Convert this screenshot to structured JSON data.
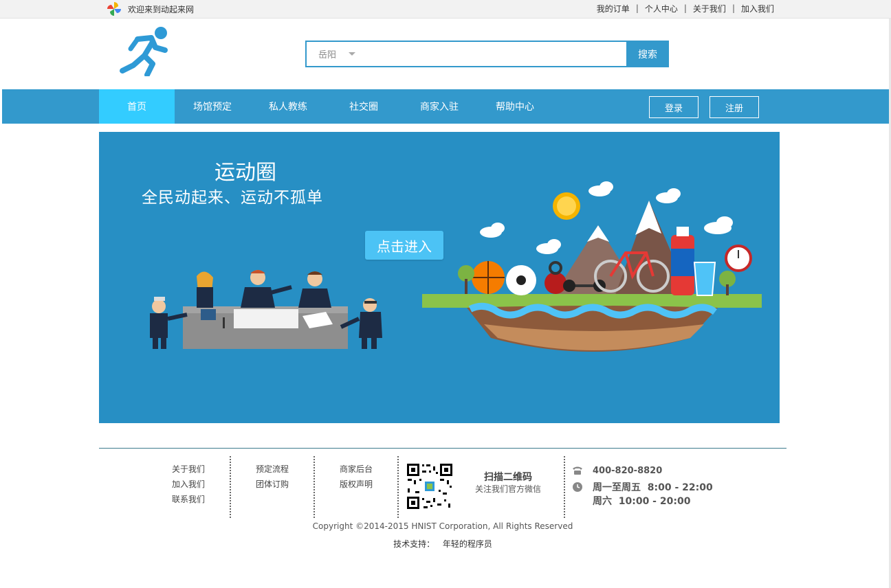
{
  "topbar": {
    "welcome": "欢迎来到动起来网",
    "links": [
      "我的订单",
      "个人中心",
      "关于我们",
      "加入我们"
    ],
    "separator": "|"
  },
  "search": {
    "city": "岳阳",
    "placeholder": "",
    "button": "搜索"
  },
  "nav": {
    "items": [
      "首页",
      "场馆预定",
      "私人教练",
      "社交圈",
      "商家入驻",
      "帮助中心"
    ],
    "active": "首页",
    "login": "登录",
    "register": "注册"
  },
  "banner": {
    "title": "运动圈",
    "slogan": "全民动起来、运动不孤单",
    "enter": "点击进入"
  },
  "footer": {
    "col1": [
      "关于我们",
      "加入我们",
      "联系我们"
    ],
    "col2": [
      "预定流程",
      "团体订购"
    ],
    "col3": [
      "商家后台",
      "版权声明"
    ],
    "scan_title": "扫描二维码",
    "scan_sub": "关注我们官方微信",
    "phone": "400-820-8820",
    "hours_weekday": "周一至周五  8:00 - 22:00",
    "hours_saturday": "周六  10:00 - 20:00",
    "copyright": "Copyright ©2014-2015 HNIST Corporation, All Rights Reserved",
    "support_label": "技术支持：",
    "support_value": "年轻的程序员"
  },
  "colors": {
    "primary": "#3399cc",
    "nav_active": "#33ccff",
    "banner_bg": "#278fc4",
    "enter_button": "#4cc3f5"
  },
  "icons": {
    "logo": "runner-icon",
    "mini_logo": "pinwheel-icon",
    "phone": "phone-icon",
    "clock": "clock-icon"
  }
}
